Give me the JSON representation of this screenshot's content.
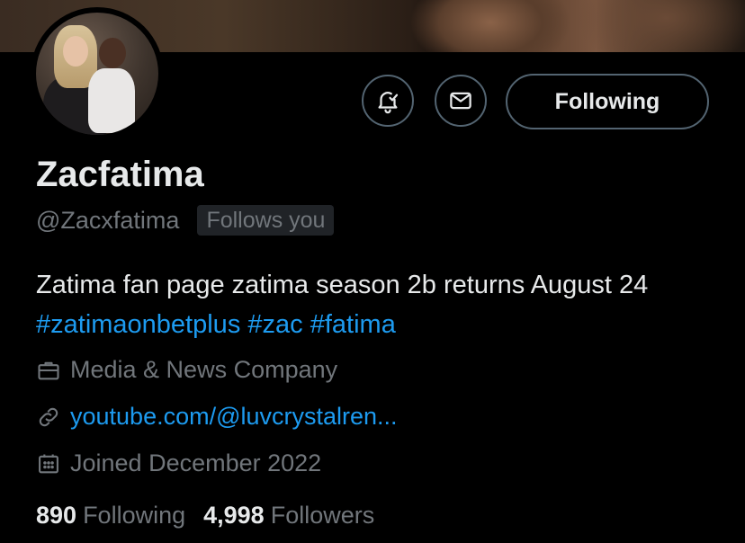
{
  "profile": {
    "display_name": "Zacfatima",
    "handle": "@Zacxfatima",
    "follows_you_badge": "Follows you",
    "bio_text": "Zatima fan page zatima season 2b returns August 24 ",
    "bio_hashtags": [
      "#zatimaonbetplus",
      "#zac",
      "#fatima"
    ],
    "category": "Media & News Company",
    "website": "youtube.com/@luvcrystalren...",
    "joined": "Joined December 2022"
  },
  "actions": {
    "notify_icon": "bell-check-icon",
    "message_icon": "envelope-icon",
    "follow_label": "Following"
  },
  "stats": {
    "following_count": "890",
    "following_label": "Following",
    "followers_count": "4,998",
    "followers_label": "Followers"
  },
  "colors": {
    "background": "#000000",
    "text": "#e7e9ea",
    "muted": "#71767b",
    "link": "#1d9bf0",
    "border": "#536471"
  }
}
